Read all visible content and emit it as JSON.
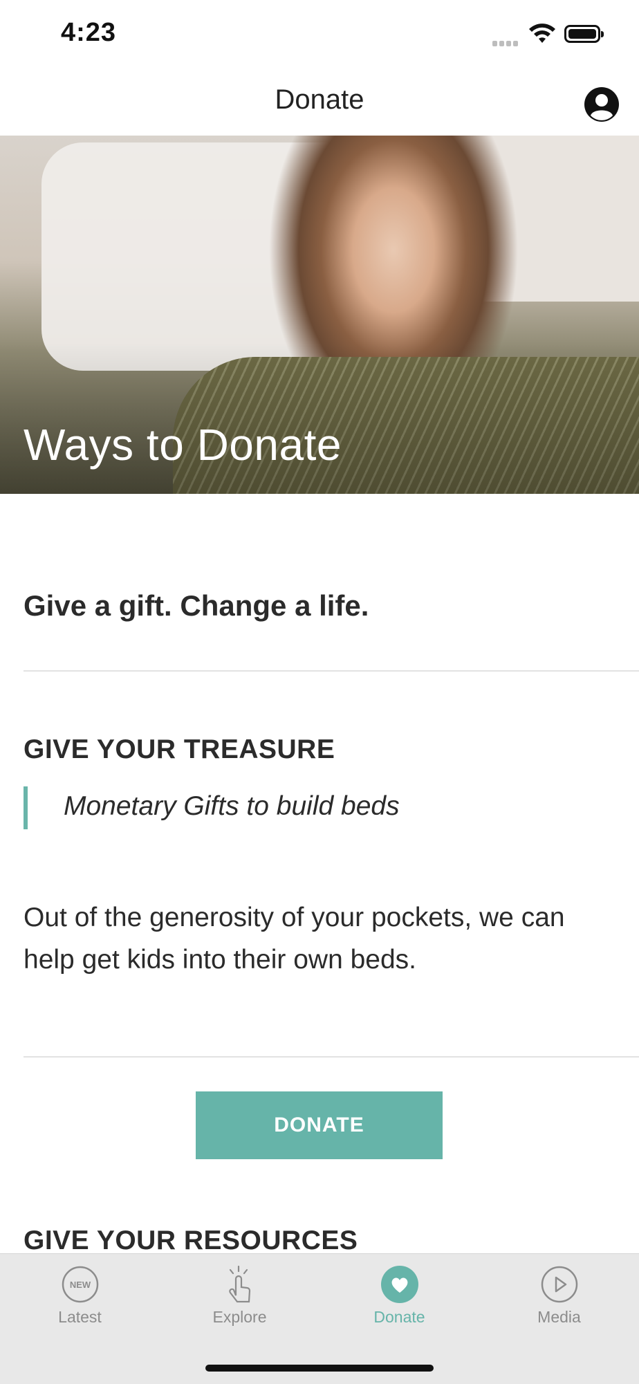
{
  "status_bar": {
    "time": "4:23"
  },
  "nav": {
    "title": "Donate"
  },
  "hero": {
    "title": "Ways to Donate"
  },
  "content": {
    "tagline": "Give a gift. Change a life.",
    "treasure": {
      "heading": "GIVE YOUR TREASURE",
      "quote": "Monetary Gifts to build beds",
      "body": "Out of the generosity of your pockets, we can help get kids into their own beds."
    },
    "donate_button": "DONATE",
    "resources": {
      "heading": "GIVE YOUR RESOURCES"
    }
  },
  "tabs": [
    {
      "label": "Latest",
      "icon": "new-icon",
      "badge": "NEW"
    },
    {
      "label": "Explore",
      "icon": "tap-icon"
    },
    {
      "label": "Donate",
      "icon": "heart-icon",
      "active": true
    },
    {
      "label": "Media",
      "icon": "play-icon"
    }
  ],
  "colors": {
    "accent": "#66b4a9",
    "text": "#2b2b2b",
    "tab_inactive": "#8c8c8c",
    "tab_bar_bg": "#e8e8e8"
  }
}
